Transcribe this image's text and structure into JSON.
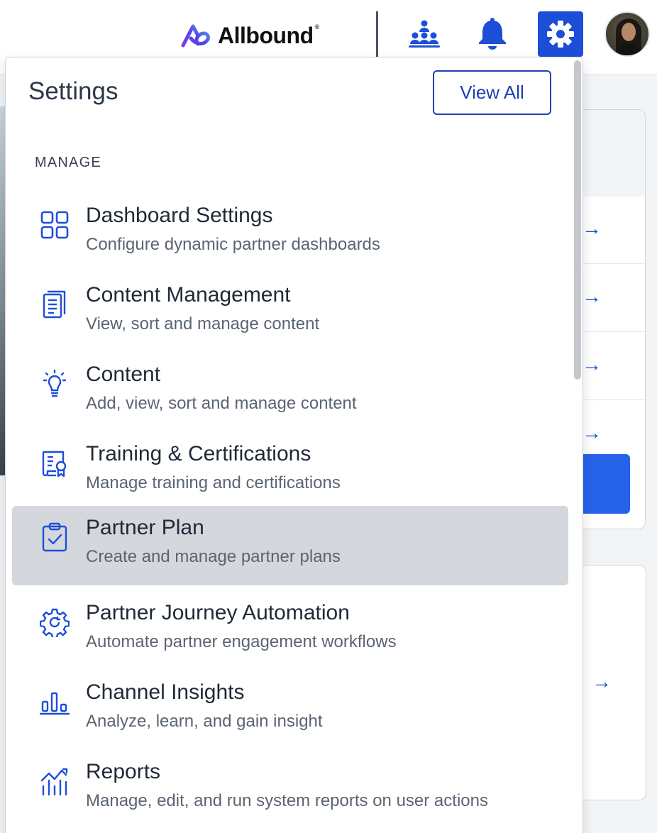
{
  "header": {
    "brand": "Allbound",
    "brand_mark": "®",
    "icons": [
      "org-chart-icon",
      "bell-icon",
      "gear-icon"
    ],
    "accent_color": "#1d4ed8"
  },
  "settings_menu": {
    "title": "Settings",
    "view_all_label": "View All",
    "section_label": "MANAGE",
    "items": [
      {
        "title": "Dashboard Settings",
        "desc": "Configure dynamic partner dashboards",
        "icon": "dashboard-grid-icon"
      },
      {
        "title": "Content Management",
        "desc": "View, sort and manage content",
        "icon": "document-icon"
      },
      {
        "title": "Content",
        "desc": "Add, view, sort and manage content",
        "icon": "lightbulb-icon"
      },
      {
        "title": "Training & Certifications",
        "desc": "Manage training and certifications",
        "icon": "certificate-icon"
      },
      {
        "title": "Partner Plan",
        "desc": "Create and manage partner plans",
        "icon": "clipboard-check-icon",
        "highlighted": true
      },
      {
        "title": "Partner Journey Automation",
        "desc": "Automate partner engagement workflows",
        "icon": "cog-refresh-icon"
      },
      {
        "title": "Channel Insights",
        "desc": "Analyze, learn, and gain insight",
        "icon": "bar-chart-icon"
      },
      {
        "title": "Reports",
        "desc": "Manage, edit, and run system reports on user actions",
        "icon": "report-chart-icon"
      }
    ]
  },
  "background": {
    "arrow_glyph": "→"
  }
}
